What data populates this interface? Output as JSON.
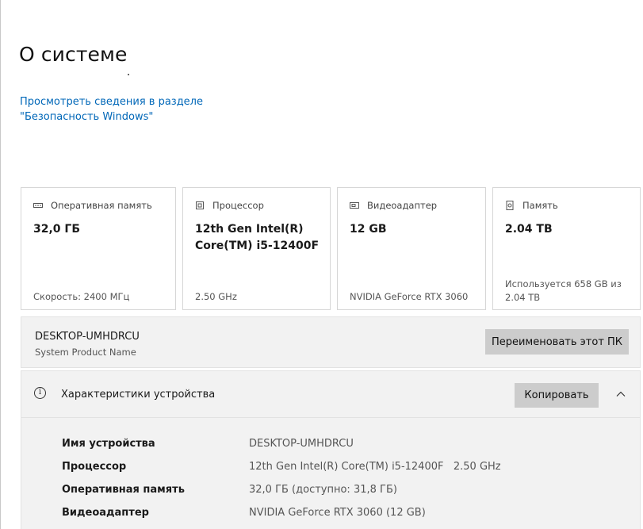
{
  "page": {
    "title": "О системе",
    "security_link": "Просмотреть сведения в разделе \"Безопасность Windows\""
  },
  "cards": [
    {
      "icon": "memory-icon",
      "label": "Оперативная память",
      "value": "32,0 ГБ",
      "footer": "Скорость: 2400 МГц"
    },
    {
      "icon": "processor-icon",
      "label": "Процессор",
      "value": "12th Gen Intel(R) Core(TM) i5-12400F",
      "footer": "2.50 GHz"
    },
    {
      "icon": "display-adapter-icon",
      "label": "Видеоадаптер",
      "value": "12 GB",
      "footer": "NVIDIA GeForce RTX 3060"
    },
    {
      "icon": "storage-icon",
      "label": "Память",
      "value": "2.04 TB",
      "footer": "Используется 658 GB из 2.04 TB"
    }
  ],
  "device": {
    "name": "DESKTOP-UMHDRCU",
    "product": "System Product Name",
    "rename_label": "Переименовать этот ПК"
  },
  "specs": {
    "title": "Характеристики устройства",
    "copy_label": "Копировать",
    "rows": [
      {
        "label": "Имя устройства",
        "value": "DESKTOP-UMHDRCU"
      },
      {
        "label": "Процессор",
        "value": "12th Gen Intel(R) Core(TM) i5-12400F   2.50 GHz"
      },
      {
        "label": "Оперативная память",
        "value": "32,0 ГБ (доступно: 31,8 ГБ)"
      },
      {
        "label": "Видеоадаптер",
        "value": "NVIDIA GeForce RTX 3060 (12 GB)"
      }
    ]
  },
  "colors": {
    "link": "#0067b8",
    "button": "#cccccc",
    "panel": "#f2f2f2"
  }
}
